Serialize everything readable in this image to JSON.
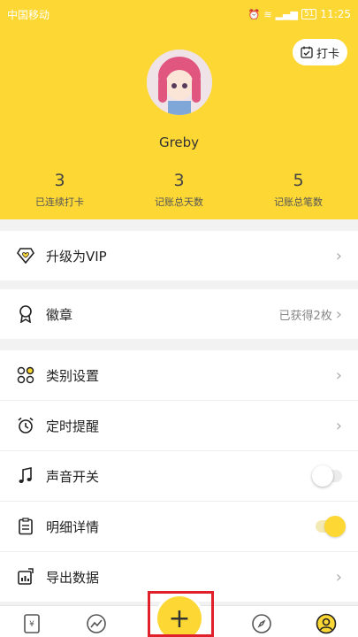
{
  "status": {
    "carrier": "中国移动",
    "time": "11:25",
    "battery": "51"
  },
  "header": {
    "checkin_label": "打卡",
    "username": "Greby",
    "stats": [
      {
        "value": "3",
        "label": "已连续打卡"
      },
      {
        "value": "3",
        "label": "记账总天数"
      },
      {
        "value": "5",
        "label": "记账总笔数"
      }
    ]
  },
  "menu": {
    "vip": "升级为VIP",
    "badges": "徽章",
    "badges_value": "已获得2枚",
    "category": "类别设置",
    "reminder": "定时提醒",
    "sound": "声音开关",
    "details": "明细详情",
    "export": "导出数据"
  },
  "toggles": {
    "sound": false,
    "details": true
  },
  "colors": {
    "accent": "#fdd835",
    "highlight": "#e0202a"
  },
  "tabbar": {
    "add": "+"
  }
}
